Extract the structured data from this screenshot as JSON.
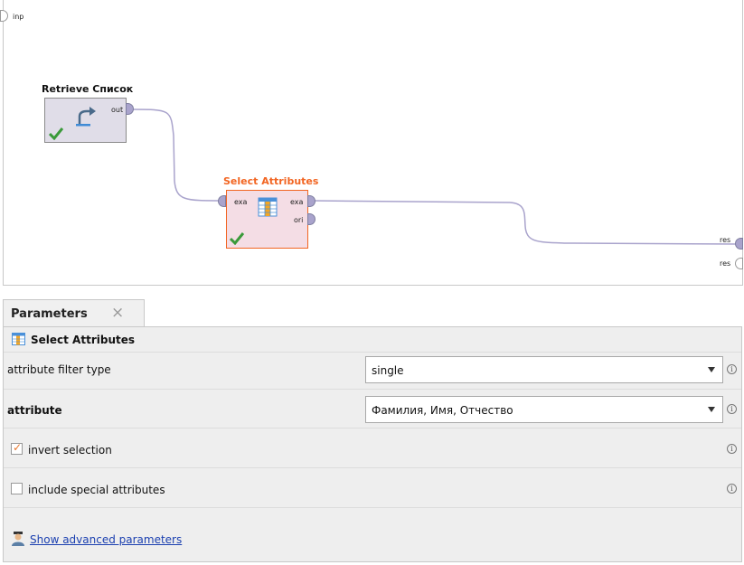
{
  "process": {
    "input_port_label": "inp",
    "result_port_labels": [
      "res",
      "res"
    ],
    "operators": [
      {
        "title": "Retrieve Список",
        "ports_out": [
          "out"
        ]
      },
      {
        "title": "Select Attributes",
        "ports_in": [
          "exa"
        ],
        "ports_out": [
          "exa",
          "ori"
        ]
      }
    ],
    "colors": {
      "connection": "#a9a3cc",
      "selected_accent": "#f26522",
      "retrieve_box": "#e0dde8",
      "select_box": "#f4dde5"
    }
  },
  "parameters_panel": {
    "tab_label": "Parameters",
    "close_icon": "×",
    "operator_name": "Select Attributes",
    "rows": [
      {
        "label": "attribute filter type",
        "value": "single"
      },
      {
        "label": "attribute",
        "value": "Фамилия, Имя, Отчество"
      },
      {
        "label": "invert selection",
        "checked": true
      },
      {
        "label": "include special attributes",
        "checked": false
      }
    ],
    "info_glyph": "i",
    "advanced_link": "Show advanced parameters"
  }
}
